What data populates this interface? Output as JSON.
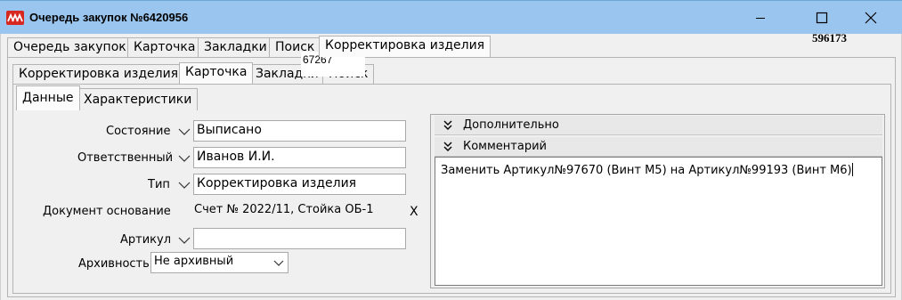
{
  "window": {
    "title": "Очередь закупок №6420956"
  },
  "outer_tabs": [
    {
      "label": "Очередь закупок"
    },
    {
      "label": "Карточка"
    },
    {
      "label": "Закладки"
    },
    {
      "label": "Поиск"
    },
    {
      "label": "Корректировка изделия",
      "active": true
    }
  ],
  "inner_tabs": [
    {
      "label": "Корректировка изделия"
    },
    {
      "label": "Карточка",
      "active": true
    },
    {
      "label": "Закладки"
    },
    {
      "label": "Поиск"
    }
  ],
  "sub_tabs": [
    {
      "label": "Данные",
      "active": true
    },
    {
      "label": "Характеристики"
    }
  ],
  "doc_number": "596173",
  "code": "67267",
  "form": {
    "state_label": "Состояние",
    "state_value": "Выписано",
    "responsible_label": "Ответственный",
    "responsible_value": "Иванов И.И.",
    "type_label": "Тип",
    "type_value": "Корректировка изделия",
    "basis_label": "Документ основание",
    "basis_value": "Счет № 2022/11, Стойка ОБ-1",
    "basis_clear": "X",
    "article_label": "Артикул",
    "article_value": "",
    "archive_label": "Архивность",
    "archive_value": "Не архивный"
  },
  "right": {
    "additional_label": "Дополнительно",
    "comment_label": "Комментарий",
    "comment_text": "Заменить Артикул№97670 (Винт М5) на Артикул№99193 (Винт М6)"
  },
  "colors": {
    "titlebar": "#99c5ee",
    "app_icon": "#d8271e",
    "background": "#f0f0f0"
  }
}
